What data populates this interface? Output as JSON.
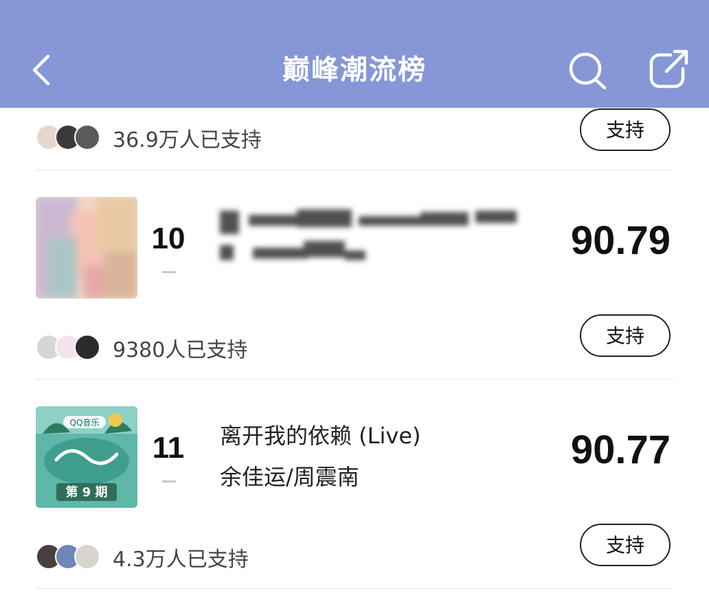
{
  "header": {
    "title": "巅峰潮流榜",
    "back_icon": "back-chevron-icon",
    "search_icon": "search-icon",
    "share_icon": "share-icon",
    "background": "#8597d7"
  },
  "top_partial": {
    "support_count": "36.9万人已支持",
    "support_label": "支持"
  },
  "songs": [
    {
      "rank": "10",
      "title": "",
      "artist": "",
      "score": "90.79",
      "trend": "—",
      "support_count": "9380人已支持",
      "support_label": "支持",
      "obscured": true
    },
    {
      "rank": "11",
      "title": "离开我的依赖 (Live)",
      "artist": "余佳运/周震南",
      "score": "90.77",
      "trend": "—",
      "support_count": "4.3万人已支持",
      "support_label": "支持",
      "cover_text": {
        "brand": "QQ音乐",
        "episode": "第 9 期"
      }
    }
  ]
}
